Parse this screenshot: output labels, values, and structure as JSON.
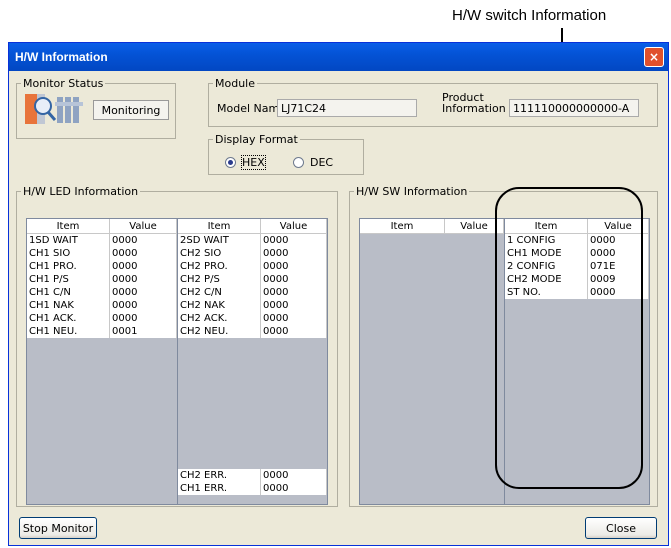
{
  "callout": {
    "text": "H/W switch Information"
  },
  "window": {
    "title": "H/W Information",
    "close_symbol": "×"
  },
  "monitor_status": {
    "legend": "Monitor Status",
    "value": "Monitoring"
  },
  "module": {
    "legend": "Module",
    "model_name_label": "Model Name",
    "model_name_value": "LJ71C24",
    "product_label_line1": "Product",
    "product_label_line2": "Information",
    "product_value": "111110000000000-A"
  },
  "display_format": {
    "legend": "Display Format",
    "hex_label": "HEX",
    "dec_label": "DEC",
    "selected": "HEX"
  },
  "led_info": {
    "legend": "H/W LED Information",
    "headers": [
      "Item",
      "Value",
      "Item",
      "Value"
    ],
    "left_rows": [
      [
        "1SD WAIT",
        "0000"
      ],
      [
        "CH1 SIO",
        "0000"
      ],
      [
        "CH1 PRO.",
        "0000"
      ],
      [
        "CH1 P/S",
        "0000"
      ],
      [
        "CH1 C/N",
        "0000"
      ],
      [
        "CH1 NAK",
        "0000"
      ],
      [
        "CH1 ACK.",
        "0000"
      ],
      [
        "CH1 NEU.",
        "0001"
      ]
    ],
    "right_rows": [
      [
        "2SD WAIT",
        "0000"
      ],
      [
        "CH2 SIO",
        "0000"
      ],
      [
        "CH2 PRO.",
        "0000"
      ],
      [
        "CH2 P/S",
        "0000"
      ],
      [
        "CH2 C/N",
        "0000"
      ],
      [
        "CH2 NAK",
        "0000"
      ],
      [
        "CH2 ACK.",
        "0000"
      ],
      [
        "CH2 NEU.",
        "0000"
      ]
    ],
    "right_bottom_rows": [
      [
        "CH2 ERR.",
        "0000"
      ],
      [
        "CH1 ERR.",
        "0000"
      ]
    ]
  },
  "sw_info": {
    "legend": "H/W SW Information",
    "headers": [
      "Item",
      "Value",
      "Item",
      "Value"
    ],
    "rows": [
      [
        "1 CONFIG",
        "0000"
      ],
      [
        "CH1 MODE",
        "0000"
      ],
      [
        "2 CONFIG",
        "071E"
      ],
      [
        "CH2 MODE",
        "0009"
      ],
      [
        "ST NO.",
        "0000"
      ]
    ]
  },
  "buttons": {
    "stop_monitor": "Stop Monitor",
    "close": "Close"
  }
}
